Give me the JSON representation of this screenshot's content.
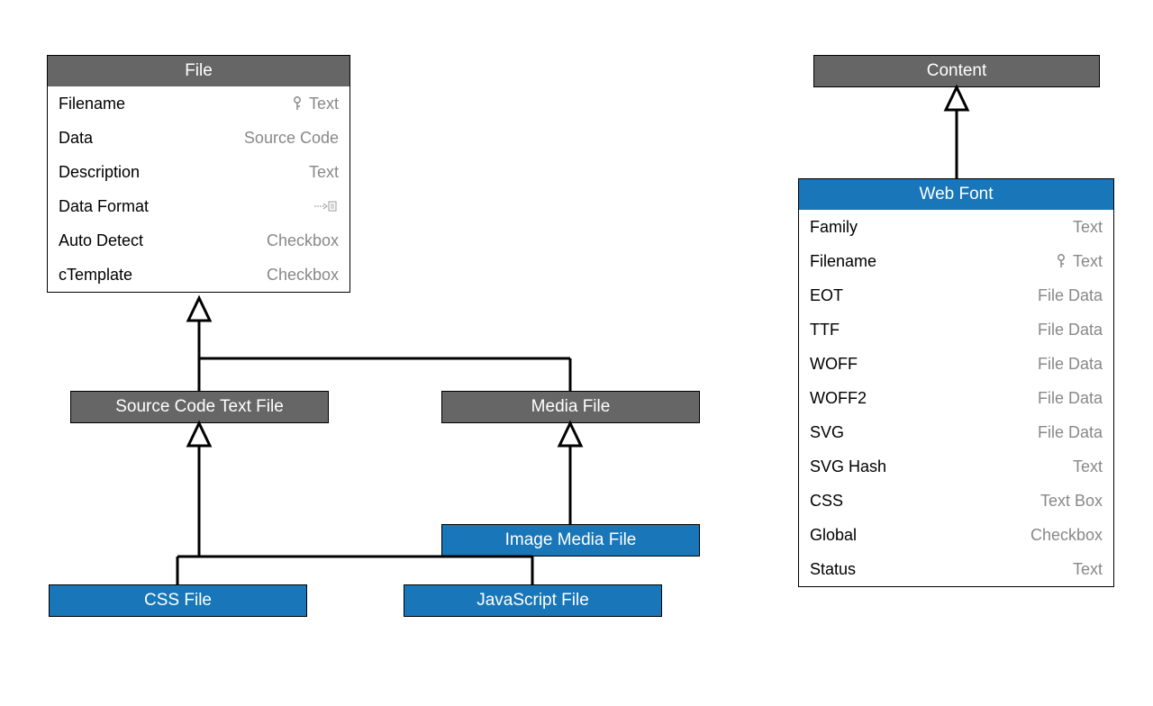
{
  "boxes": {
    "file": {
      "title": "File",
      "attrs": [
        {
          "name": "Filename",
          "type": "Text",
          "key": true
        },
        {
          "name": "Data",
          "type": "Source Code"
        },
        {
          "name": "Description",
          "type": "Text"
        },
        {
          "name": "Data Format",
          "type": "",
          "linkIcon": true
        },
        {
          "name": "Auto Detect",
          "type": "Checkbox"
        },
        {
          "name": "cTemplate",
          "type": "Checkbox"
        }
      ]
    },
    "source_code_text_file": {
      "title": "Source Code Text File"
    },
    "media_file": {
      "title": "Media File"
    },
    "css_file": {
      "title": "CSS File"
    },
    "javascript_file": {
      "title": "JavaScript File"
    },
    "image_media_file": {
      "title": "Image Media File"
    },
    "content": {
      "title": "Content"
    },
    "web_font": {
      "title": "Web Font",
      "attrs": [
        {
          "name": "Family",
          "type": "Text"
        },
        {
          "name": "Filename",
          "type": "Text",
          "key": true
        },
        {
          "name": "EOT",
          "type": "File Data"
        },
        {
          "name": "TTF",
          "type": "File Data"
        },
        {
          "name": "WOFF",
          "type": "File Data"
        },
        {
          "name": "WOFF2",
          "type": "File Data"
        },
        {
          "name": "SVG",
          "type": "File Data"
        },
        {
          "name": "SVG Hash",
          "type": "Text"
        },
        {
          "name": "CSS",
          "type": "Text Box"
        },
        {
          "name": "Global",
          "type": "Checkbox"
        },
        {
          "name": "Status",
          "type": "Text"
        }
      ]
    }
  }
}
